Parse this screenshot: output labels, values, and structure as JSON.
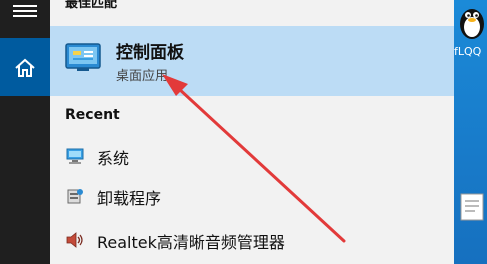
{
  "panel": {
    "section_header": "最佳匹配",
    "best_match": {
      "title": "控制面板",
      "subtitle": "桌面应用",
      "icon": "control-panel-icon"
    },
    "recent_header": "Recent",
    "recent_items": [
      {
        "label": "系统",
        "icon": "system-monitor-icon"
      },
      {
        "label": "卸载程序",
        "icon": "uninstall-program-icon"
      },
      {
        "label": "Realtek高清晰音频管理器",
        "icon": "speaker-icon"
      }
    ]
  },
  "desktop": {
    "qq_label": "fLQQ"
  },
  "colors": {
    "rail": "#1f1f1f",
    "rail_selected": "#005b9f",
    "panel_bg": "#f2f2f2",
    "best_match_highlight": "#bcdcf5",
    "annotation_arrow": "#e23a3a",
    "desktop_bg": "#1b8ad8"
  }
}
